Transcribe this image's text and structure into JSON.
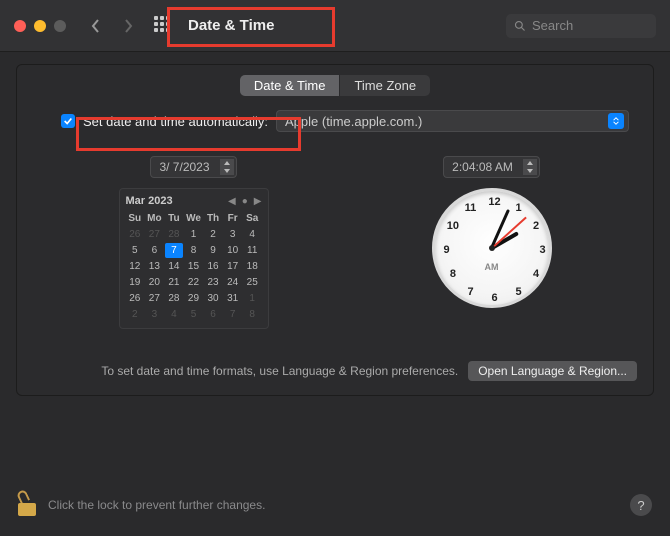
{
  "window": {
    "title": "Date & Time",
    "search_placeholder": "Search"
  },
  "tabs": {
    "date_time": "Date & Time",
    "time_zone": "Time Zone"
  },
  "auto": {
    "checked": true,
    "label": "Set date and time automatically:",
    "server": "Apple (time.apple.com.)"
  },
  "date_field": "3/  7/2023",
  "time_field": "2:04:08 AM",
  "calendar": {
    "title": "Mar 2023",
    "dow": [
      "Su",
      "Mo",
      "Tu",
      "We",
      "Th",
      "Fr",
      "Sa"
    ],
    "leading_dim": [
      26,
      27,
      28
    ],
    "days": [
      1,
      2,
      3,
      4,
      5,
      6,
      7,
      8,
      9,
      10,
      11,
      12,
      13,
      14,
      15,
      16,
      17,
      18,
      19,
      20,
      21,
      22,
      23,
      24,
      25,
      26,
      27,
      28,
      29,
      30,
      31
    ],
    "trailing_dim": [
      1,
      2,
      3,
      4,
      5,
      6,
      7,
      8
    ],
    "selected": 7
  },
  "clock": {
    "numerals": [
      "12",
      "1",
      "2",
      "3",
      "4",
      "5",
      "6",
      "7",
      "8",
      "9",
      "10",
      "11"
    ],
    "ampm": "AM"
  },
  "hint": "To set date and time formats, use Language & Region preferences.",
  "open_button": "Open Language & Region...",
  "footer_text": "Click the lock to prevent further changes.",
  "help": "?"
}
